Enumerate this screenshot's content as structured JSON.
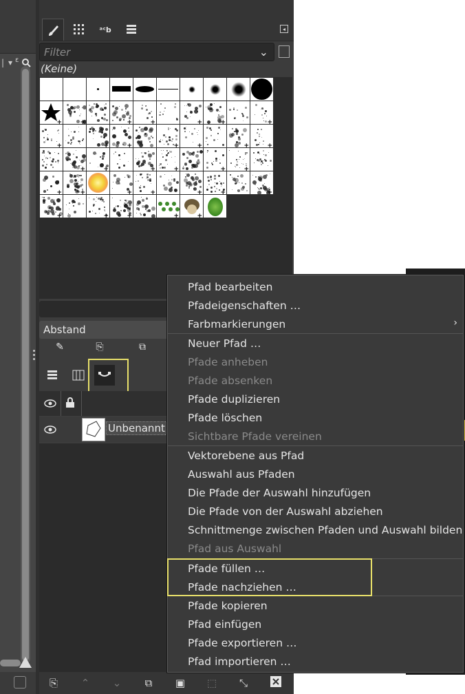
{
  "dock": {
    "filter_placeholder": "Filter",
    "brush_selected": "(Keine)",
    "spacing_label": "Abstand",
    "tabs": [
      "paintbrush-icon",
      "pattern-icon",
      "font-icon",
      "document-history-icon"
    ]
  },
  "paths_panel": {
    "path_name": "Unbenannt"
  },
  "context_menu": {
    "items": [
      {
        "label": "Pfad bearbeiten",
        "enabled": true
      },
      {
        "label": "Pfadeigenschaften …",
        "enabled": true
      },
      {
        "label": "Farbmarkierungen",
        "enabled": true,
        "submenu": true
      },
      {
        "label": "Neuer Pfad …",
        "enabled": true
      },
      {
        "label": "Pfade anheben",
        "enabled": false
      },
      {
        "label": "Pfade absenken",
        "enabled": false
      },
      {
        "label": "Pfade duplizieren",
        "enabled": true
      },
      {
        "label": "Pfade löschen",
        "enabled": true
      },
      {
        "label": "Sichtbare Pfade vereinen",
        "enabled": false
      },
      {
        "label": "Vektorebene aus Pfad",
        "enabled": true
      },
      {
        "label": "Auswahl aus Pfaden",
        "enabled": true
      },
      {
        "label": "Die Pfade der Auswahl hinzufügen",
        "enabled": true
      },
      {
        "label": "Die Pfade von der Auswahl abziehen",
        "enabled": true
      },
      {
        "label": "Schnittmenge zwischen Pfaden und Auswahl bilden",
        "enabled": true
      },
      {
        "label": "Pfad aus Auswahl",
        "enabled": false
      },
      {
        "label": "Pfade füllen …",
        "enabled": true
      },
      {
        "label": "Pfade nachziehen …",
        "enabled": true
      },
      {
        "label": "Pfade kopieren",
        "enabled": true
      },
      {
        "label": "Pfad einfügen",
        "enabled": true
      },
      {
        "label": "Pfade exportieren …",
        "enabled": true
      },
      {
        "label": "Pfad importieren …",
        "enabled": true
      }
    ]
  },
  "colors": {
    "highlight": "#e8e06a",
    "panel_bg": "#3c3c3c",
    "menu_bg": "#3a3a3a"
  }
}
